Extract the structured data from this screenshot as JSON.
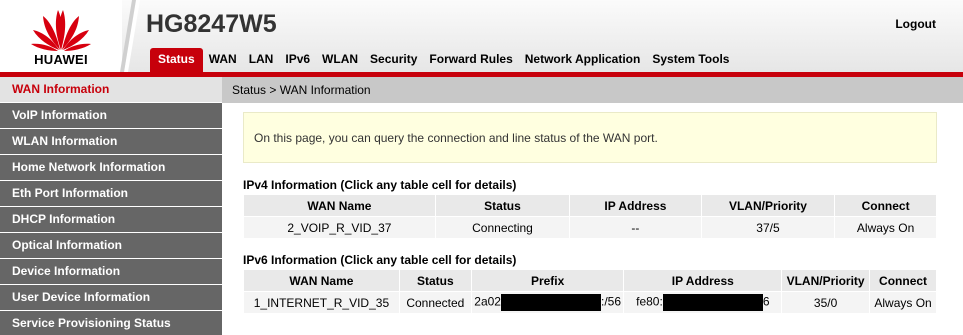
{
  "brand": {
    "logo_text": "HUAWEI",
    "model": "HG8247W5",
    "logout_label": "Logout",
    "accent_color": "#c7000b"
  },
  "nav": {
    "tabs": [
      {
        "label": "Status"
      },
      {
        "label": "WAN"
      },
      {
        "label": "LAN"
      },
      {
        "label": "IPv6"
      },
      {
        "label": "WLAN"
      },
      {
        "label": "Security"
      },
      {
        "label": "Forward Rules"
      },
      {
        "label": "Network Application"
      },
      {
        "label": "System Tools"
      }
    ]
  },
  "sidebar": {
    "items": [
      {
        "label": "WAN Information"
      },
      {
        "label": "VoIP Information"
      },
      {
        "label": "WLAN Information"
      },
      {
        "label": "Home Network Information"
      },
      {
        "label": "Eth Port Information"
      },
      {
        "label": "DHCP Information"
      },
      {
        "label": "Optical Information"
      },
      {
        "label": "Device Information"
      },
      {
        "label": "User Device Information"
      },
      {
        "label": "Service Provisioning Status"
      }
    ]
  },
  "breadcrumb": "Status > WAN Information",
  "info_text": "On this page, you can query the connection and line status of the WAN port.",
  "ipv4": {
    "title": "IPv4 Information (Click any table cell for details)",
    "headers": [
      "WAN Name",
      "Status",
      "IP Address",
      "VLAN/Priority",
      "Connect"
    ],
    "rows": [
      [
        "2_VOIP_R_VID_37",
        "Connecting",
        "--",
        "37/5",
        "Always On"
      ]
    ]
  },
  "ipv6": {
    "title": "IPv6 Information (Click any table cell for details)",
    "headers": [
      "WAN Name",
      "Status",
      "Prefix",
      "IP Address",
      "VLAN/Priority",
      "Connect"
    ],
    "rows": [
      {
        "wan_name": "1_INTERNET_R_VID_35",
        "status": "Connected",
        "prefix_start": "2a02",
        "prefix_end": ":/56",
        "ip_start": "fe80:",
        "ip_end": "6",
        "vlan": "35/0",
        "connect": "Always On"
      }
    ]
  }
}
